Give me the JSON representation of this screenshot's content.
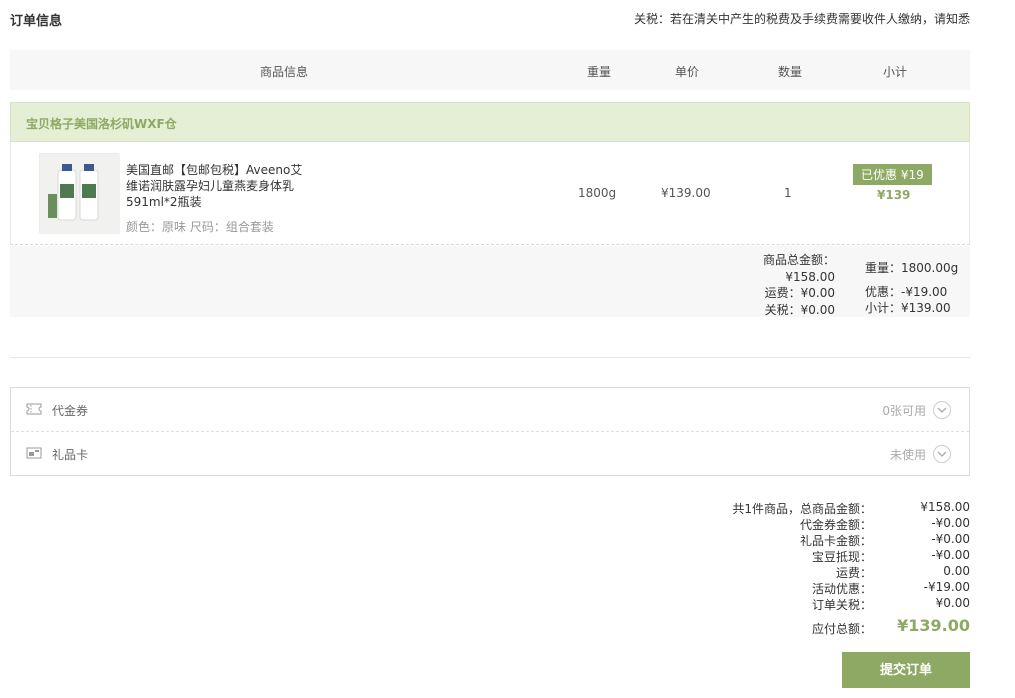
{
  "order": {
    "title": "订单信息",
    "tax_notice": "关税：若在清关中产生的税费及手续费需要收件人缴纳，请知悉"
  },
  "table_header": {
    "info": "商品信息",
    "weight": "重量",
    "price": "单价",
    "quantity": "数量",
    "subtotal": "小计"
  },
  "warehouse": {
    "name": "宝贝格子美国洛杉矶WXF仓"
  },
  "item": {
    "name": "美国直邮【包邮包税】Aveeno艾维诺润肤露孕妇儿童燕麦身体乳591ml*2瓶装",
    "attrs": "颜色：原味  尺码：组合套装",
    "weight": "1800g",
    "price": "¥139.00",
    "quantity": "1",
    "discount_badge": "已优惠 ¥19",
    "subtotal": "¥139"
  },
  "warehouse_summary": {
    "goods_total": "商品总金额：¥158.00",
    "shipping": "运费：¥0.00",
    "tax": "关税：¥0.00",
    "weight": "重量：1800.00g",
    "discount": "优惠：-¥19.00",
    "subtotal": "小计：¥139.00"
  },
  "coupons": {
    "voucher_label": "代金券",
    "voucher_status": "0张可用",
    "giftcard_label": "礼品卡",
    "giftcard_status": "未使用"
  },
  "totals": {
    "rows": [
      {
        "label": "共1件商品，总商品金额：",
        "value": "¥158.00"
      },
      {
        "label": "代金券金额：",
        "value": "-¥0.00"
      },
      {
        "label": "礼品卡金额：",
        "value": "-¥0.00"
      },
      {
        "label": "宝豆抵现：",
        "value": "-¥0.00"
      },
      {
        "label": "运费：",
        "value": "0.00"
      },
      {
        "label": "活动优惠：",
        "value": "-¥19.00"
      },
      {
        "label": "订单关税：",
        "value": "¥0.00"
      }
    ],
    "grand_label": "应付总额：",
    "grand_value": "¥139.00"
  },
  "submit_label": "提交订单",
  "colors": {
    "accent": "#8ea964",
    "warehouse_bg": "#e4efd6",
    "header_bg": "#f7f7f7"
  },
  "icons": {
    "voucher": "ticket-icon",
    "giftcard": "gift-card-icon",
    "expand": "chevron-down-icon"
  }
}
